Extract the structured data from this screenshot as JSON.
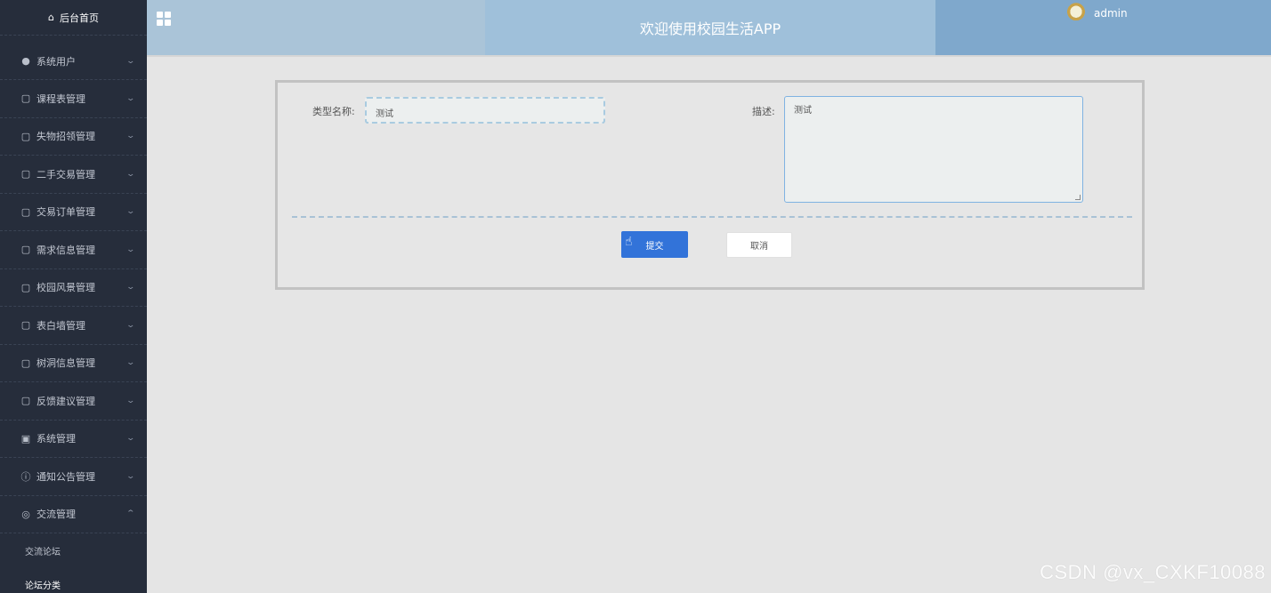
{
  "sidebar": {
    "home": {
      "icon": "home-icon",
      "label": "后台首页"
    },
    "items": [
      {
        "icon": "user-icon",
        "label": "系统用户"
      },
      {
        "icon": "note-icon",
        "label": "课程表管理"
      },
      {
        "icon": "note-icon",
        "label": "失物招领管理"
      },
      {
        "icon": "note-icon",
        "label": "二手交易管理"
      },
      {
        "icon": "note-icon",
        "label": "交易订单管理"
      },
      {
        "icon": "note-icon",
        "label": "需求信息管理"
      },
      {
        "icon": "note-icon",
        "label": "校园风景管理"
      },
      {
        "icon": "note-icon",
        "label": "表白墙管理"
      },
      {
        "icon": "note-icon",
        "label": "树洞信息管理"
      },
      {
        "icon": "note-icon",
        "label": "反馈建议管理"
      },
      {
        "icon": "image-icon",
        "label": "系统管理"
      },
      {
        "icon": "info-icon",
        "label": "通知公告管理"
      },
      {
        "icon": "chat-icon",
        "label": "交流管理"
      }
    ],
    "subitems": [
      {
        "label": "交流论坛"
      },
      {
        "label": "论坛分类"
      }
    ]
  },
  "header": {
    "title": "欢迎使用校园生活APP",
    "username": "admin"
  },
  "form": {
    "type_label": "类型名称:",
    "type_value": "测试",
    "desc_label": "描述:",
    "desc_value": "测试",
    "submit_label": "提交",
    "cancel_label": "取消"
  },
  "watermark": "CSDN @vx_CXKF10088",
  "colors": {
    "sidebar_bg": "#262d3b",
    "header_left": "#aac4d8",
    "header_mid": "#9fc0da",
    "header_right": "#7fa8cc",
    "primary": "#3273d9"
  }
}
